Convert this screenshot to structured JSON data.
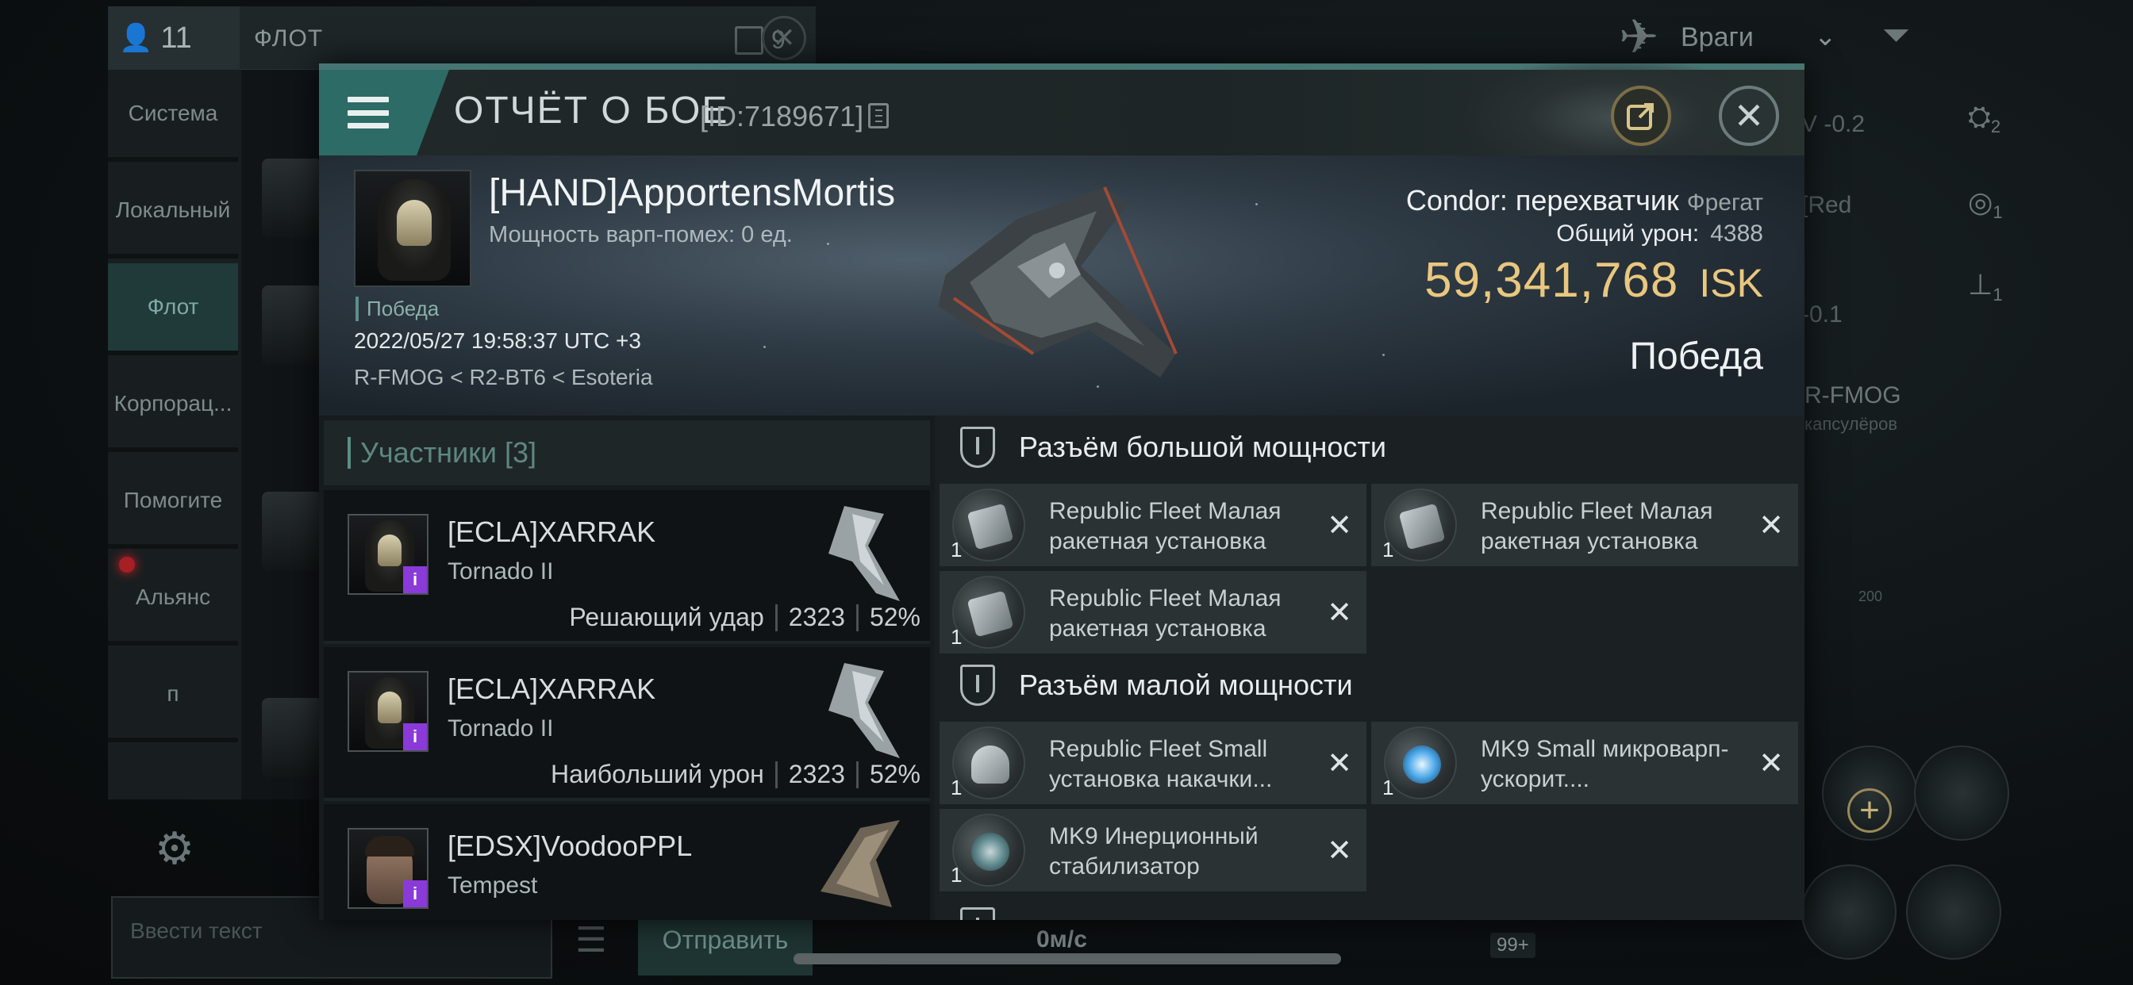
{
  "chat": {
    "member_count": "11",
    "title": "ФЛОТ",
    "count": "9",
    "tabs": [
      "Система",
      "Локальный",
      "Флот",
      "Корпорац...",
      "Помогите",
      "Альянс",
      "п"
    ],
    "input_placeholder": "Ввести текст",
    "send_label": "Отправить"
  },
  "hud": {
    "enemies_label": "Враги",
    "rows": [
      "V -0.2",
      "[Red",
      "-0.1"
    ],
    "icon_counts": [
      "2",
      "1",
      "1"
    ],
    "system_name": "R-FMOG",
    "system_sub": "капсулёров",
    "scale_label": "200",
    "speed": "0м/с",
    "badge": "99+"
  },
  "report": {
    "title": "ОТЧЁТ О БОЕ",
    "id": "[ID:7189671]",
    "pilot": "[HAND]ApportensMortis",
    "warp": "Мощность варп-помех: 0 ед.",
    "victory_tag": "Победа",
    "datetime": "2022/05/27 19:58:37 UTC +3",
    "location": "R-FMOG < R2-BT6 < Esoteria",
    "ship_name": "Condor: перехватчик",
    "ship_class": "Фрегат",
    "damage_label": "Общий урон:",
    "damage_value": "4388",
    "isk_value": "59,341,768",
    "isk_currency": "ISK",
    "result": "Победа"
  },
  "participants": {
    "label": "Участники [3]",
    "items": [
      {
        "name": "[ECLA]XARRAK",
        "ship": "Tornado II",
        "role": "Решающий удар",
        "damage": "2323",
        "percent": "52%"
      },
      {
        "name": "[ECLA]XARRAK",
        "ship": "Tornado II",
        "role": "Наибольший урон",
        "damage": "2323",
        "percent": "52%"
      },
      {
        "name": "[EDSX]VoodooPPL",
        "ship": "Tempest",
        "role": "",
        "damage": "",
        "percent": ""
      }
    ]
  },
  "fitting": {
    "high_label": "Разъём большой мощности",
    "low_label": "Разъём малой мощности",
    "high": [
      {
        "qty": "1",
        "name": "Republic Fleet Малая ракетная установка"
      },
      {
        "qty": "1",
        "name": "Republic Fleet Малая ракетная установка"
      },
      {
        "qty": "1",
        "name": "Republic Fleet Малая ракетная установка"
      }
    ],
    "low": [
      {
        "qty": "1",
        "name": "Republic Fleet Small установка накачки..."
      },
      {
        "qty": "1",
        "name": "MK9 Small микроварп-ускорит...."
      },
      {
        "qty": "1",
        "name": "MK9 Инерционный стабилизатор"
      }
    ],
    "close_glyph": "✕"
  }
}
